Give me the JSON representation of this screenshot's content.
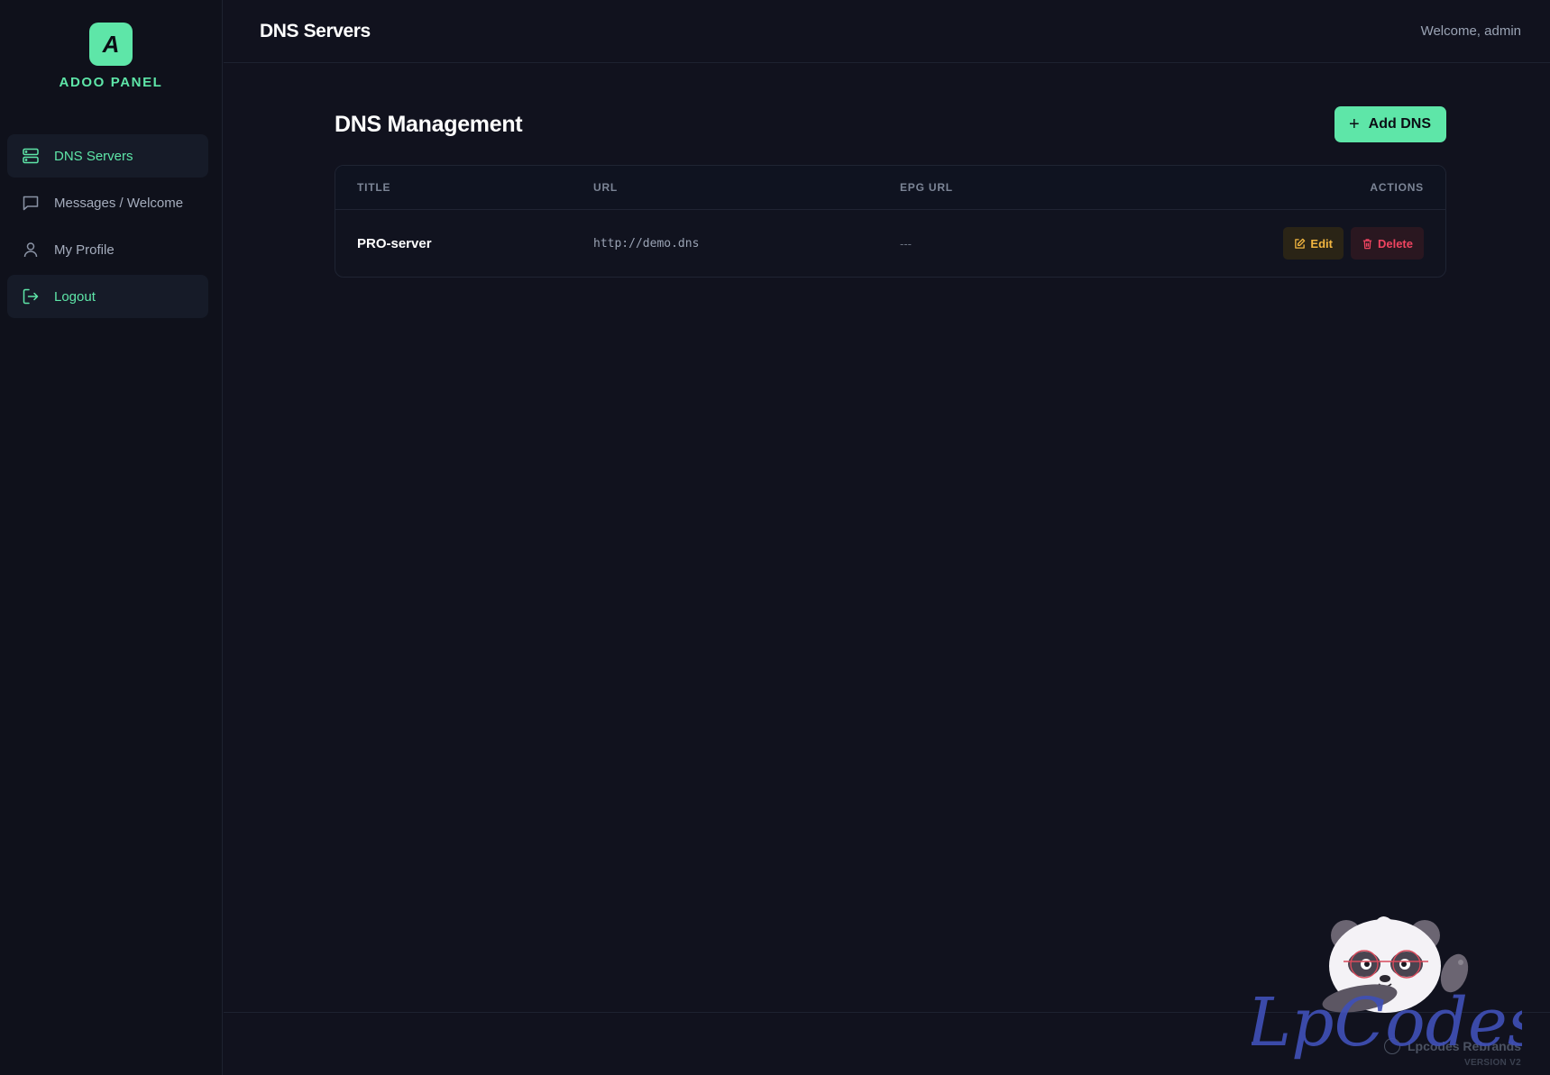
{
  "brand": {
    "logo_letter": "A",
    "name": "ADOO PANEL"
  },
  "sidebar": {
    "items": [
      {
        "label": "DNS Servers",
        "icon": "server-icon",
        "active": true
      },
      {
        "label": "Messages / Welcome",
        "icon": "message-icon",
        "active": false
      },
      {
        "label": "My Profile",
        "icon": "user-icon",
        "active": false
      },
      {
        "label": "Logout",
        "icon": "logout-icon",
        "active": false
      }
    ]
  },
  "header": {
    "title": "DNS Servers",
    "welcome": "Welcome, admin"
  },
  "main": {
    "title": "DNS Management",
    "add_button": "Add DNS",
    "table": {
      "columns": [
        "TITLE",
        "URL",
        "EPG URL",
        "ACTIONS"
      ],
      "rows": [
        {
          "title": "PRO-server",
          "url": "http://demo.dns",
          "epg_url": "---"
        }
      ],
      "edit_label": "Edit",
      "delete_label": "Delete"
    }
  },
  "footer": {
    "credit": "Lpcodes Rebrands",
    "version": "VERSION V2"
  },
  "watermark": {
    "text": "LpCodes"
  },
  "colors": {
    "accent": "#5ee6a8",
    "background": "#11121e",
    "edit": "#f2b640",
    "delete": "#ef4460"
  }
}
